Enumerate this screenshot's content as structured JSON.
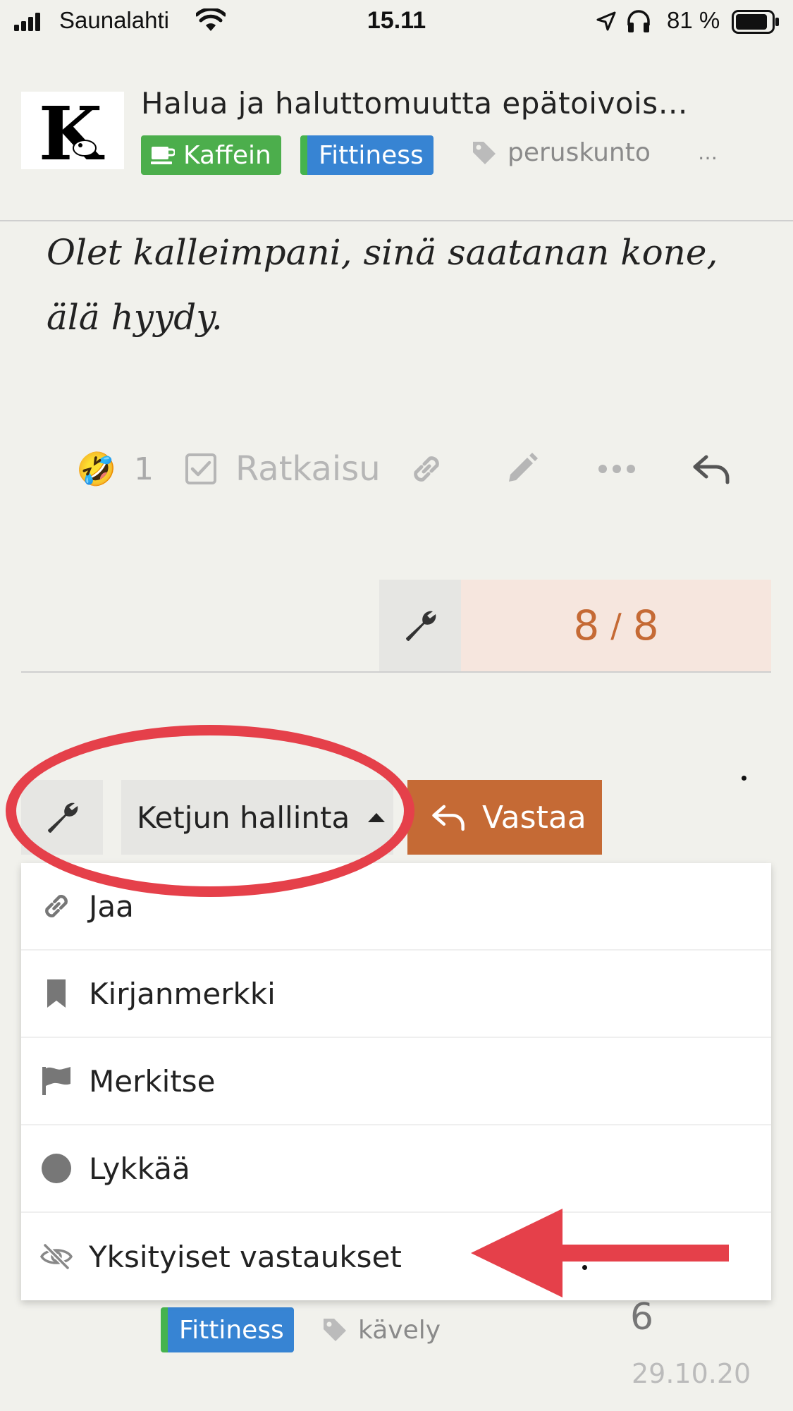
{
  "status_bar": {
    "carrier": "Saunalahti",
    "time": "15.11",
    "battery": "81 %"
  },
  "header": {
    "title": "Halua ja haluttomuutta epätoivois…",
    "category_1": "Kaffein",
    "category_2": "Fittiness",
    "tag": "peruskunto",
    "more": "…"
  },
  "post": {
    "text": "Olet kalleimpani, sinä saatanan kone, älä hyydy.",
    "reaction_emoji": "🤣",
    "reaction_count": "1",
    "solution_label": "Ratkaisu"
  },
  "timeline": {
    "current": "8",
    "separator": "/",
    "total": "8"
  },
  "controls": {
    "menu_label": "Ketjun hallinta",
    "reply_label": "Vastaa"
  },
  "dropdown": {
    "items": [
      {
        "label": "Jaa",
        "icon": "link-icon"
      },
      {
        "label": "Kirjanmerkki",
        "icon": "bookmark-icon"
      },
      {
        "label": "Merkitse",
        "icon": "flag-icon"
      },
      {
        "label": "Lykkää",
        "icon": "circle-icon"
      },
      {
        "label": "Yksityiset vastaukset",
        "icon": "eye-slash-icon"
      }
    ]
  },
  "suggested": {
    "category": "Fittiness",
    "tag": "kävely",
    "count": "6",
    "date": "29.10.20"
  },
  "colors": {
    "accent": "#c56a35",
    "annotation": "#e5404a",
    "category_green": "#4cae4c",
    "category_blue": "#3784d3"
  }
}
